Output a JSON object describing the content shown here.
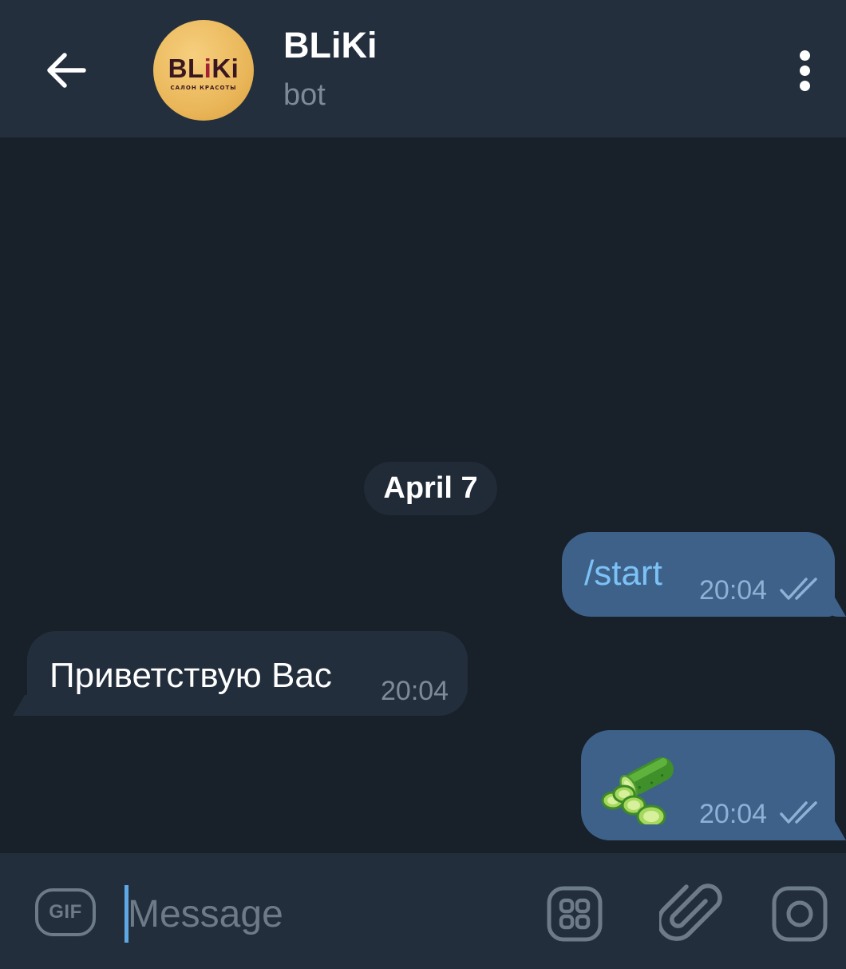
{
  "header": {
    "chat_name": "BLiKi",
    "chat_status": "bot",
    "avatar": {
      "logo_prefix": "BL",
      "logo_accent": "i",
      "logo_suffix": "Ki",
      "subtitle": "САЛОН КРАСОТЫ"
    },
    "back_icon": "arrow-left-icon",
    "menu_icon": "more-vertical-icon"
  },
  "chat": {
    "date_separator": "April 7",
    "messages": [
      {
        "direction": "outgoing",
        "text": "/start",
        "time": "20:04",
        "status": "read"
      },
      {
        "direction": "incoming",
        "text": "Приветствую Вас",
        "time": "20:04"
      },
      {
        "direction": "outgoing",
        "emoji": "cucumber",
        "time": "20:04",
        "status": "read"
      }
    ]
  },
  "input_bar": {
    "gif_label": "GIF",
    "placeholder": "Message",
    "icons": [
      "sticker-grid-icon",
      "paperclip-icon",
      "camera-icon"
    ]
  },
  "colors": {
    "header_bg": "#242f3d",
    "chat_bg": "#18202a",
    "outgoing_bubble": "#3e6189",
    "incoming_bubble": "#232e3c",
    "command_link": "#7cc2f6"
  }
}
